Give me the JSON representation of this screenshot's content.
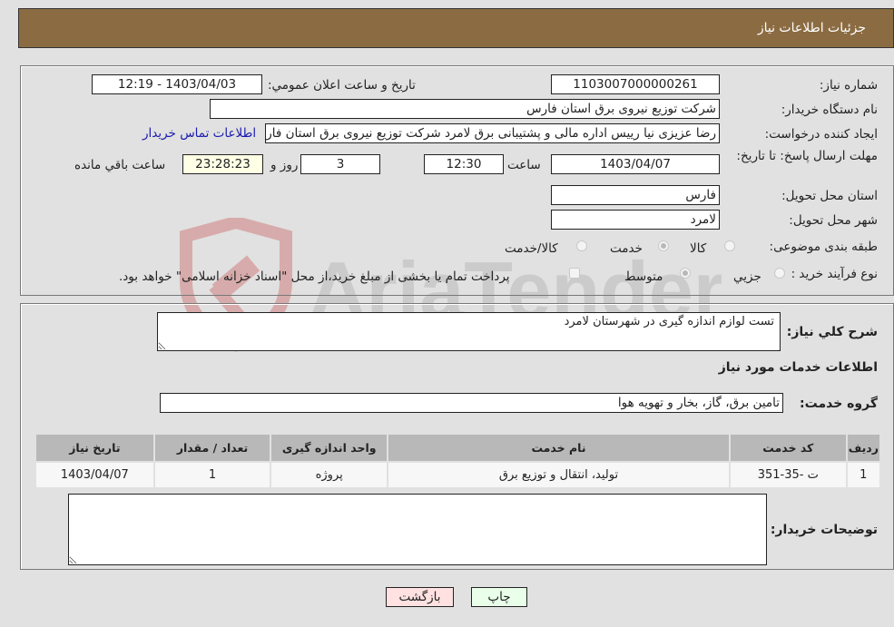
{
  "header": {
    "title": "جزئیات اطلاعات نیاز"
  },
  "form": {
    "need_number": {
      "label": "شماره نیاز:",
      "value": "1103007000000261"
    },
    "announce_datetime": {
      "label": "تاریخ و ساعت اعلان عمومي:",
      "value": "1403/04/03 - 12:19"
    },
    "buyer_org": {
      "label": "نام دستگاه خریدار:",
      "value": "شرکت توزیع نیروی برق استان فارس"
    },
    "requester": {
      "label": "ایجاد کننده درخواست:",
      "value": "رضا عزیزی نیا رییس اداره مالی و پشتیبانی برق لامرد شرکت توزیع نیروی برق استان فارس"
    },
    "buyer_contact_link": "اطلاعات تماس خریدار",
    "deadline": {
      "label": "مهلت ارسال پاسخ: تا تاریخ:",
      "date": "1403/04/07",
      "time_label": "ساعت",
      "time": "12:30",
      "days": "3",
      "days_label": "روز و",
      "remaining": "23:28:23",
      "remaining_label": "ساعت باقي مانده"
    },
    "delivery_province": {
      "label": "استان محل تحویل:",
      "value": "فارس"
    },
    "delivery_city": {
      "label": "شهر محل تحویل:",
      "value": "لامرد"
    },
    "category": {
      "label": "طبقه بندی موضوعی:",
      "options": [
        "کالا",
        "خدمت",
        "کالا/خدمت"
      ],
      "selected": "خدمت"
    },
    "purchase_process": {
      "label": "نوع فرآیند خرید :",
      "options": [
        "جزيي",
        "متوسط"
      ],
      "selected": "متوسط",
      "treasury_note": "پرداخت تمام یا بخشی از مبلغ خرید،از محل \"اسناد خزانه اسلامی\" خواهد بود.",
      "treasury_checked": false
    }
  },
  "details": {
    "general_desc": {
      "label": "شرح كلي نياز:",
      "value": "تست لوازم اندازه گیری در شهرستان لامرد"
    },
    "services_title": "اطلاعات خدمات مورد نیاز",
    "service_group": {
      "label": "گروه خدمت:",
      "value": "تامین برق، گاز، بخار و تهویه هوا"
    },
    "table": {
      "headers": [
        "ردیف",
        "کد خدمت",
        "نام خدمت",
        "واحد اندازه گیری",
        "تعداد / مقدار",
        "تاریخ نیاز"
      ],
      "rows": [
        [
          "1",
          "ت -35-351",
          "تولید، انتقال و توزیع برق",
          "پروژه",
          "1",
          "1403/04/07"
        ]
      ]
    },
    "buyer_notes": {
      "label": "توضیحات خریدار:",
      "value": ""
    }
  },
  "buttons": {
    "print": "چاپ",
    "back": "بازگشت"
  },
  "watermark": {
    "text": "AriaTender.neT",
    "colors": {
      "shield": "#d9a0a0",
      "text": "#c4c4c4"
    }
  }
}
